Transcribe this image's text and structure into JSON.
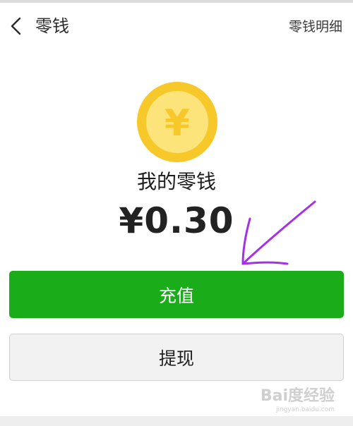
{
  "header": {
    "title": "零钱",
    "detail_link": "零钱明细"
  },
  "wallet": {
    "coin_symbol": "¥",
    "label": "我的零钱",
    "balance": "¥0.30"
  },
  "actions": {
    "recharge_label": "充值",
    "withdraw_label": "提现"
  },
  "watermark": {
    "brand": "Bai度经验",
    "url": "jingyan.baidu.com"
  },
  "colors": {
    "primary_green": "#1aad19",
    "coin_outer": "#f6c829",
    "coin_inner": "#fde47a",
    "annotation_arrow": "#a531e6"
  }
}
